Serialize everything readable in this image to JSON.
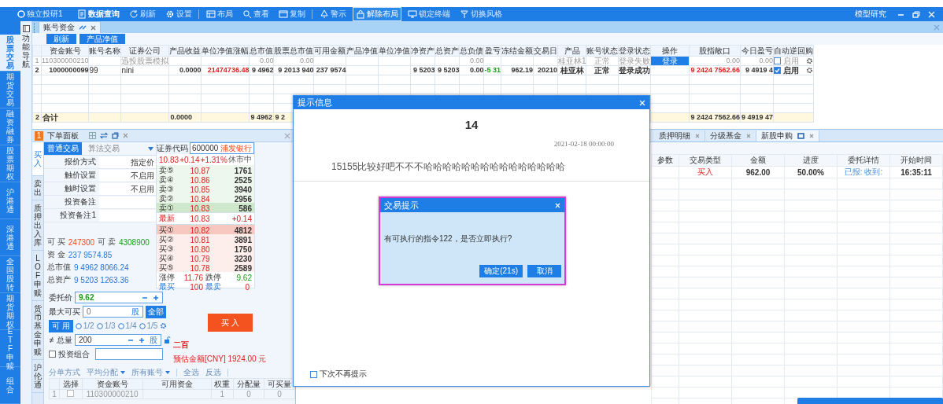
{
  "title_bar": {
    "app_name": "独立投研1",
    "menu": [
      {
        "label": "数据查询",
        "bold": true,
        "selected": false,
        "separator_before": false
      },
      {
        "label": "刷新",
        "bold": false,
        "selected": false,
        "separator_before": false
      },
      {
        "label": "设置",
        "bold": false,
        "selected": false,
        "separator_before": false
      },
      {
        "label": "布局",
        "bold": false,
        "selected": false,
        "separator_before": true
      },
      {
        "label": "查看",
        "bold": false,
        "selected": false,
        "separator_before": false
      },
      {
        "label": "复制",
        "bold": false,
        "selected": false,
        "separator_before": false
      },
      {
        "label": "警示",
        "bold": false,
        "selected": false,
        "separator_before": true
      },
      {
        "label": "解除布局",
        "bold": false,
        "selected": true,
        "separator_before": false
      },
      {
        "label": "锁定终端",
        "bold": false,
        "selected": false,
        "separator_before": false
      },
      {
        "label": "切换风格",
        "bold": false,
        "selected": false,
        "separator_before": false
      }
    ],
    "right_label": "模型研究"
  },
  "sidebar": {
    "items": [
      {
        "label": "股票交易",
        "selected": true
      },
      {
        "label": "期货交易",
        "selected": false
      },
      {
        "label": "融资融券",
        "selected": false
      },
      {
        "label": "股票期权",
        "selected": false
      },
      {
        "label": "沪港通",
        "selected": false
      },
      {
        "label": "深港通",
        "selected": false
      },
      {
        "label": "全国股转",
        "selected": false
      },
      {
        "label": "期货期权",
        "selected": false
      },
      {
        "label": "ETF申赎",
        "selected": false
      },
      {
        "label": "组合",
        "selected": false
      }
    ]
  },
  "nav_strip": {
    "label": "功能导航"
  },
  "account_panel": {
    "tab": {
      "label": "账号资金"
    },
    "toolbar": [
      "刷新",
      "产品净值"
    ],
    "table": {
      "columns": [
        {
          "label": "资金账号",
          "kind": "number"
        },
        {
          "label": "账号名称",
          "kind": "text"
        },
        {
          "label": "证券公司",
          "kind": "text"
        },
        {
          "label": "产品收益",
          "kind": "number"
        },
        {
          "label": "单位净值涨幅",
          "kind": "number",
          "color": "#e02020"
        },
        {
          "label": "总市值",
          "kind": "number"
        },
        {
          "label": "股票总市值",
          "kind": "number"
        },
        {
          "label": "可用金额",
          "kind": "number"
        },
        {
          "label": "产品净值",
          "kind": "number"
        },
        {
          "label": "单位净值",
          "kind": "number"
        },
        {
          "label": "净资产",
          "kind": "number"
        },
        {
          "label": "总资产",
          "kind": "number"
        },
        {
          "label": "总负债",
          "kind": "number"
        },
        {
          "label": "盈亏",
          "kind": "number",
          "color": "#1aa01a"
        },
        {
          "label": "冻结金额",
          "kind": "number"
        },
        {
          "label": "交易日",
          "kind": "number"
        },
        {
          "label": "产品",
          "kind": "center"
        },
        {
          "label": "账号状态",
          "kind": "center"
        },
        {
          "label": "登录状态",
          "kind": "center"
        },
        {
          "label": "操作",
          "kind": "action"
        },
        {
          "label": "股指敞口",
          "kind": "number",
          "color": "#e02020"
        },
        {
          "label": "今日盈亏",
          "kind": "number"
        },
        {
          "label": "自动逆回购",
          "kind": "toggle"
        }
      ],
      "rows": [
        {
          "no": "1",
          "disabled": true,
          "cells": [
            "110300000210",
            null,
            "迅投股票模拟",
            null,
            null,
            "0.00",
            "0.00",
            null,
            null,
            null,
            null,
            null,
            "0.00",
            null,
            null,
            null,
            "桂亚林1",
            "正常",
            "登录失败",
            "登录",
            "0.00",
            "0.00"
          ],
          "auto_repo": {
            "label": "启用",
            "checked": false
          }
        },
        {
          "no": "2",
          "disabled": false,
          "cells": [
            "1000000099",
            "99",
            "nini",
            "0.0000",
            "21474736.48",
            "9 4962",
            "9 2013 940",
            "237 9574",
            null,
            null,
            "9 5203",
            "9 5203",
            "0.00",
            "-5 31",
            "962.19",
            "20210",
            "桂亚林",
            "正常",
            "登录成功",
            null,
            "9 2424 7562.66",
            "9 4919 4"
          ],
          "auto_repo": {
            "label": "启用",
            "checked": true
          }
        }
      ],
      "total": {
        "no": "2",
        "cells": [
          "合计",
          null,
          null,
          "0.0000",
          null,
          "9 4962",
          "9 2",
          null,
          null,
          null,
          null,
          null,
          null,
          null,
          null,
          null,
          null,
          null,
          null,
          null,
          "9 2424 7562.66",
          "9 4919 47"
        ]
      }
    }
  },
  "order_panel": {
    "badge": "1",
    "title": "下单面板",
    "side_tabs": [
      {
        "label": "买入",
        "selected": true
      },
      {
        "label": "卖出",
        "selected": false
      },
      {
        "label": "质押出入库",
        "selected": false
      },
      {
        "label": "LOF申赎",
        "selected": false
      },
      {
        "label": "货币基金申赎",
        "selected": false
      },
      {
        "label": "沪伦通",
        "selected": false
      }
    ],
    "mode_tabs": [
      {
        "label": "普通交易",
        "selected": true
      },
      {
        "label": "算法交易",
        "selected": false
      }
    ],
    "settings": [
      {
        "label": "报价方式",
        "value": "指定价"
      },
      {
        "label": "触价设置",
        "value": "不启用"
      },
      {
        "label": "触时设置",
        "value": "不启用"
      },
      {
        "label": "投资备注"
      },
      {
        "label": "投资备注1"
      }
    ],
    "quote": {
      "code_label": "证券代码",
      "code": "600000",
      "name": "浦发银行",
      "price": "10.83",
      "change": "+0.14",
      "pct": "+1.31%",
      "status": "休市中",
      "asks": [
        {
          "label": "卖⑤",
          "price": "10.87",
          "volume": "1761",
          "highlighted": false
        },
        {
          "label": "卖④",
          "price": "10.86",
          "volume": "2525",
          "highlighted": false
        },
        {
          "label": "卖③",
          "price": "10.85",
          "volume": "3940",
          "highlighted": false
        },
        {
          "label": "卖②",
          "price": "10.84",
          "volume": "2956",
          "highlighted": false
        },
        {
          "label": "卖①",
          "price": "10.83",
          "volume": "586",
          "highlighted": true
        }
      ],
      "last": {
        "label": "最新",
        "price": "10.83",
        "change": "+0.14"
      },
      "bids": [
        {
          "label": "买①",
          "price": "10.82",
          "volume": "4812",
          "highlighted": true
        },
        {
          "label": "买②",
          "price": "10.81",
          "volume": "3891",
          "highlighted": false
        },
        {
          "label": "买③",
          "price": "10.80",
          "volume": "1750",
          "highlighted": false
        },
        {
          "label": "买④",
          "price": "10.79",
          "volume": "3230",
          "highlighted": false
        },
        {
          "label": "买⑤",
          "price": "10.78",
          "volume": "2589",
          "highlighted": false
        }
      ],
      "limit_up_label": "涨停",
      "limit_up": "11.76",
      "limit_down_label": "跌停",
      "limit_down": "9.62",
      "buy_label": "最买",
      "buy": "100",
      "sell_label": "最卖",
      "sell": "0"
    },
    "funds": {
      "can_buy_label": "可 买",
      "can_buy": "247300",
      "can_sell_label": "可 卖",
      "can_sell": "4308900",
      "rows": [
        {
          "label": "资 金",
          "value": "237 9574.85"
        },
        {
          "label": "总市值",
          "value": "9 4962 8066.24"
        },
        {
          "label": "总资产",
          "value": "9 5203 1263.36"
        }
      ]
    },
    "price": {
      "label": "委托价",
      "value": "9.62"
    },
    "max_buy": {
      "label": "最大可买",
      "placeholder": "0",
      "unit": "股",
      "button": "全部"
    },
    "ratio": {
      "label": "可 用",
      "options": [
        {
          "label": "1/2",
          "selected": false
        },
        {
          "label": "1/3",
          "selected": false
        },
        {
          "label": "1/4",
          "selected": false
        },
        {
          "label": "1/5",
          "selected": false
        }
      ]
    },
    "quantity": {
      "label": "总量",
      "value": "200",
      "unit": "股"
    },
    "amount_words": "二百",
    "estimate": "预估金额[CNY] 1924.00 元",
    "portfolio": {
      "label": "投资组合",
      "checked": false
    },
    "buy_button": "买 入",
    "split": {
      "label": "分单方式",
      "method": "平均分配",
      "accounts": "所有账号",
      "select_all": "全选",
      "invert": "反选"
    },
    "sub_table": {
      "select_column": "选择",
      "columns": [
        "资金账号",
        "可用资金",
        "权重",
        "分配量",
        "可买量"
      ],
      "rows": [
        {
          "no": "1",
          "checked": false,
          "cells": [
            "110300000210",
            null,
            "1",
            "0",
            "0"
          ]
        }
      ]
    }
  },
  "orders_panel": {
    "tabs": [
      {
        "label": "质押明细",
        "selected": false
      },
      {
        "label": "分级基金",
        "selected": false
      },
      {
        "label": "新股申购",
        "selected": true
      }
    ],
    "table": {
      "columns": [
        "参数",
        "交易类型",
        "金额",
        "进度",
        "委托详情",
        "开始时间"
      ],
      "rows": [
        {
          "cells": [
            null,
            "买入",
            "962.00",
            "50.00%",
            "已报: 收到:",
            "16:35:11"
          ]
        }
      ]
    }
  },
  "notice_dialog": {
    "title": "提示信息",
    "heading": "14",
    "date": "2021-02-18 00:00:00",
    "message": "15155比较好吧不不不哈哈哈哈哈哈哈哈哈哈哈哈哈哈哈",
    "dont_show": {
      "label": "下次不再提示",
      "checked": false
    }
  },
  "trade_dialog": {
    "title": "交易提示",
    "message": "有可执行的指令122，是否立即执行?",
    "buttons": [
      "确定(21s)",
      "取消"
    ]
  }
}
